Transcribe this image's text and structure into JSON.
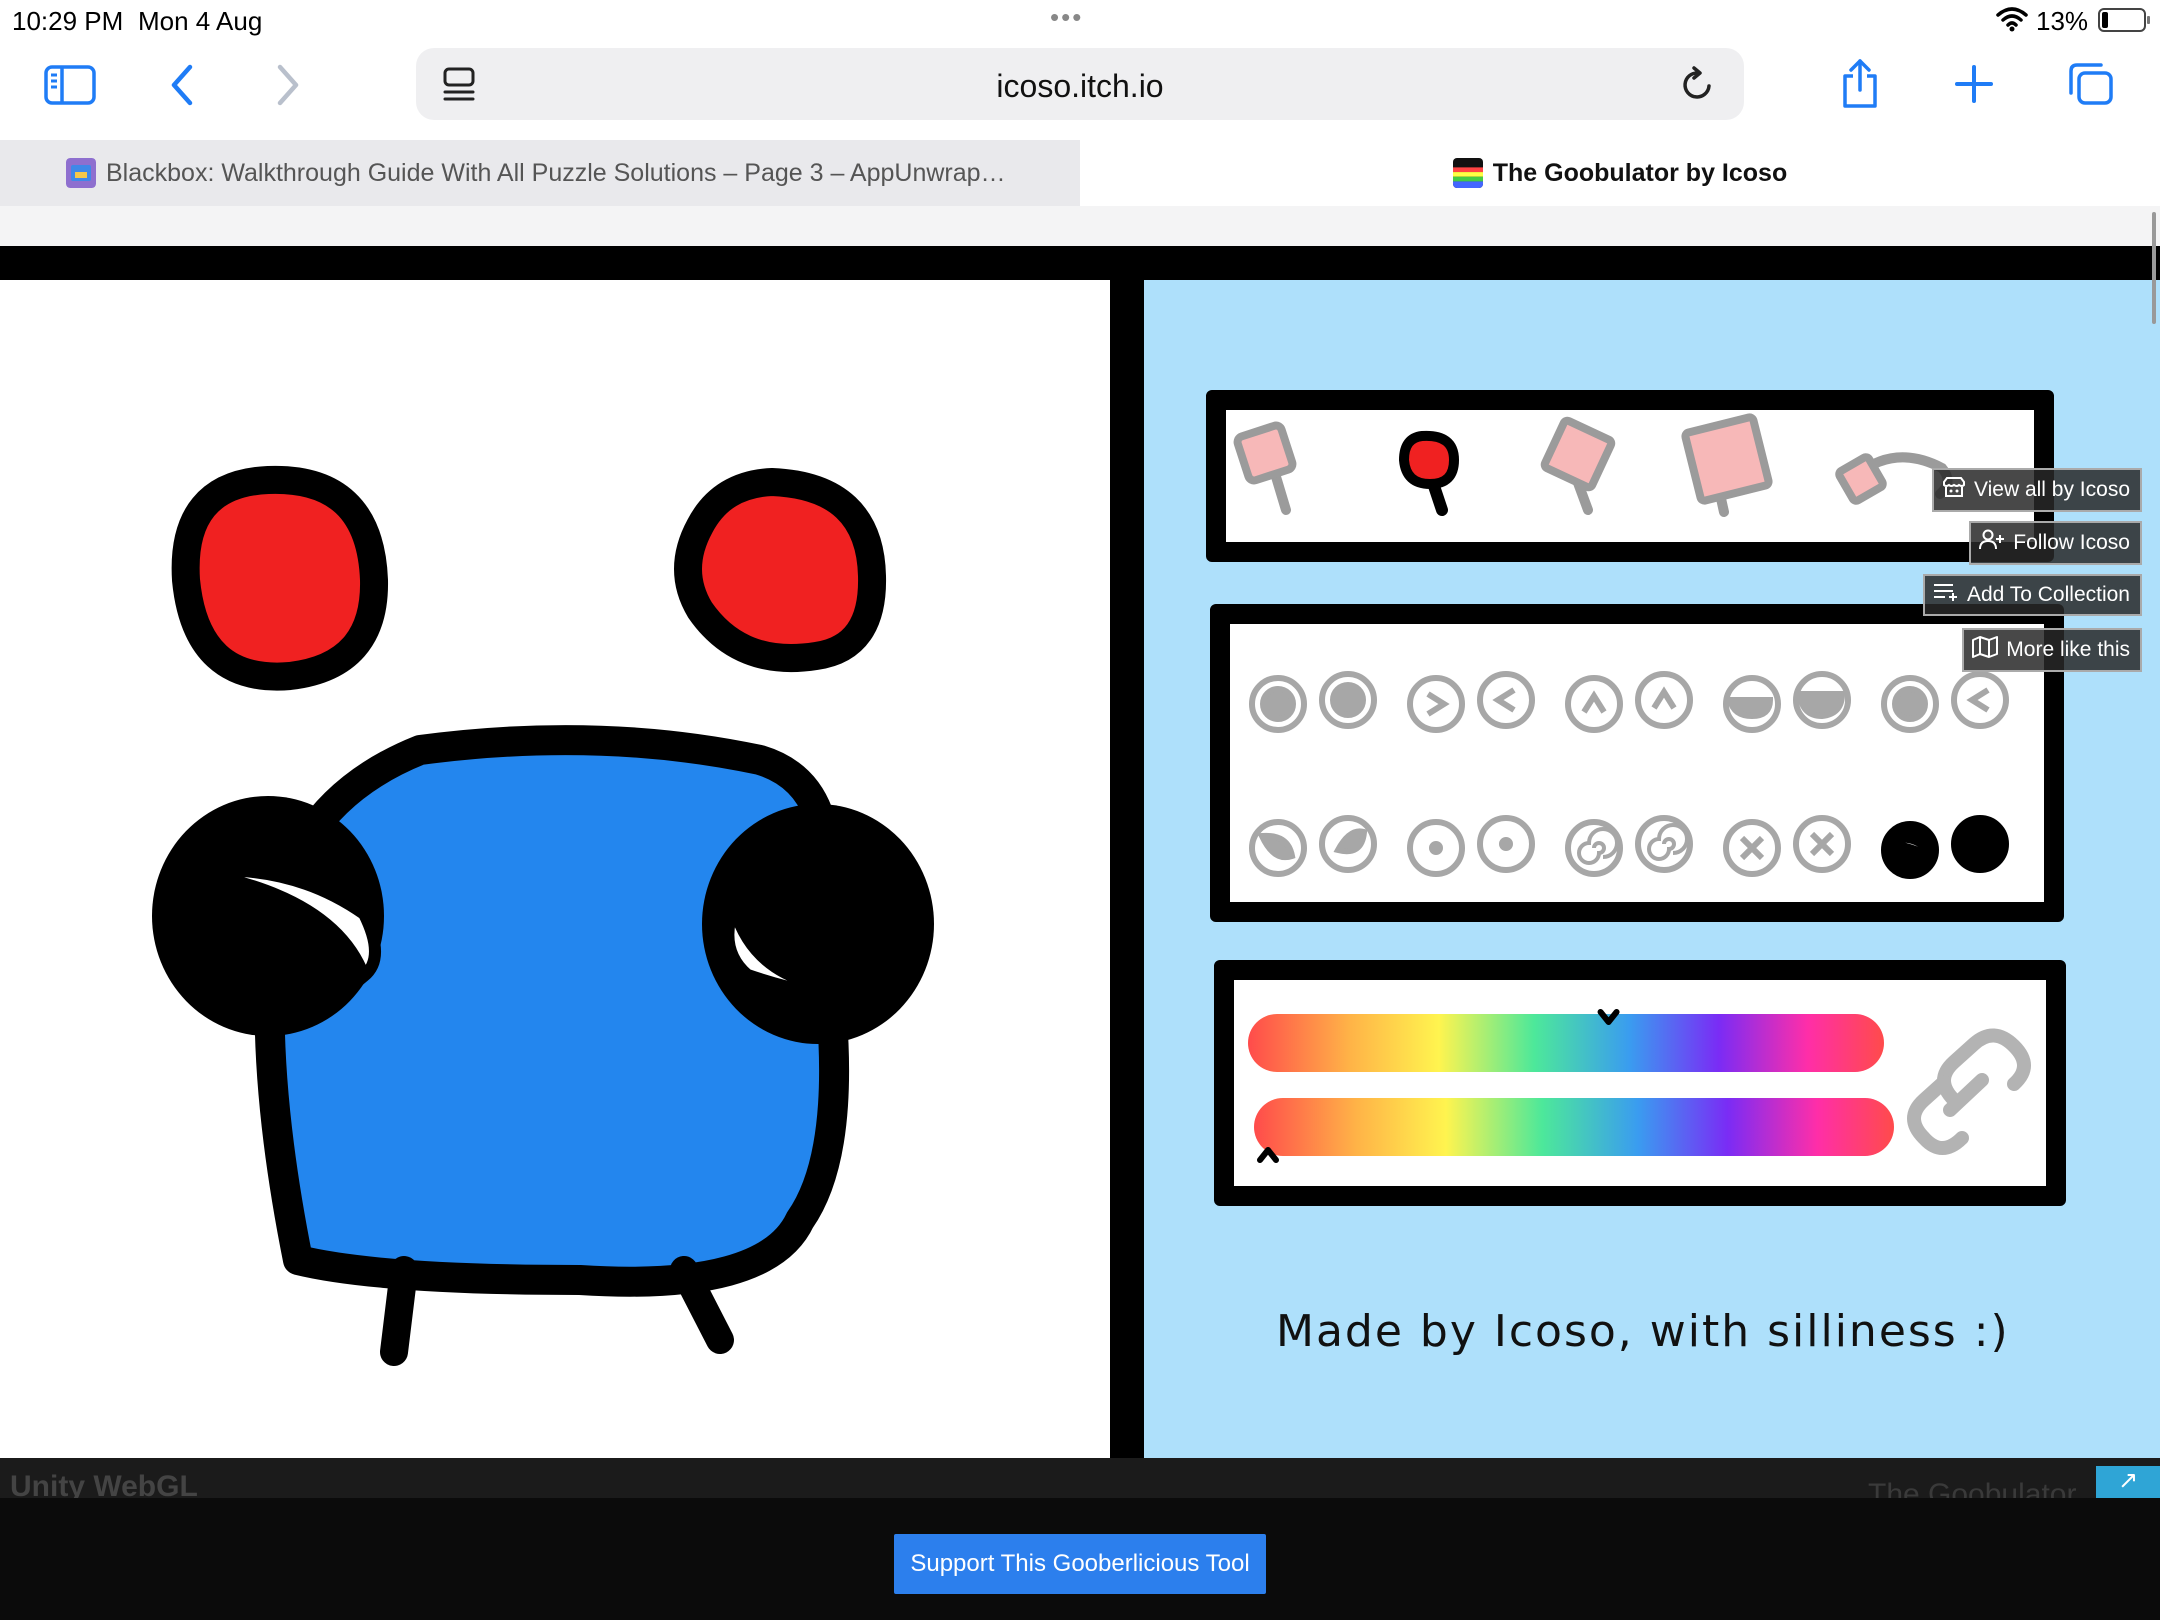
{
  "status_bar": {
    "time": "10:29 PM",
    "date": "Mon 4 Aug",
    "dots": "•••",
    "battery": "13%"
  },
  "toolbar": {
    "url": "icoso.itch.io",
    "accent_color": "#1f7cf6"
  },
  "tabs": [
    {
      "title": "Blackbox: Walkthrough Guide With All Puzzle Solutions – Page 3 – AppUnwrap…",
      "active": false
    },
    {
      "title": "The Goobulator by Icoso",
      "active": true
    }
  ],
  "tab_close_glyph": "×",
  "itch_buttons": {
    "view_all": "View all by Icoso",
    "follow": "Follow Icoso",
    "add_collection": "Add To Collection",
    "more_like": "More like this"
  },
  "game": {
    "credit": "Made by Icoso, with silliness :)",
    "body_color": "#2386ee",
    "antenna_color": "#f02121",
    "panel_color": "#aee0fb",
    "selected_antenna_index": 1,
    "selected_eye_index": 11,
    "hue_slider_top": 0.57,
    "hue_slider_bottom": 0.0
  },
  "bottom": {
    "engine_label": "Unity WebGL",
    "game_name": "The Goobulator",
    "fullscreen_glyph": "↗",
    "support_button": "Support This Gooberlicious Tool"
  }
}
